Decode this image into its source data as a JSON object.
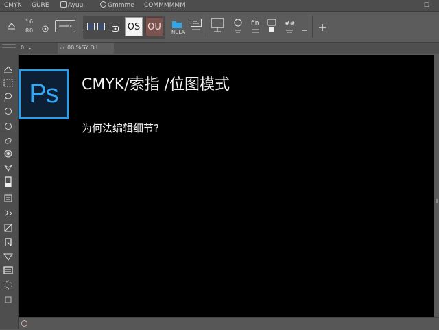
{
  "menubar": {
    "items": [
      "CMYK",
      "GURE",
      "Ayuu",
      "Gmmme",
      "COMMMMMM"
    ],
    "close_glyph": "☐"
  },
  "optbar": {
    "os_label": "OS",
    "ou_label": "OU",
    "folder_label": "NULA"
  },
  "tabbar": {
    "zoom_text": "0",
    "doc_tab": "00 %GY D",
    "tab_marker": "l"
  },
  "document": {
    "logo_text": "Ps",
    "title": "CMYK/索指 /位图模式",
    "subtitle": "为何法编辑细节?"
  },
  "colors": {
    "canvas": "#000000",
    "ps_accent": "#2e9de8",
    "ps_bg": "#0c1f35",
    "ou_button": "#7b5450"
  },
  "tools": [
    "move-tool-icon",
    "marquee-tool-icon",
    "lasso-tool-icon",
    "quick-select-tool-icon",
    "crop-tool-icon",
    "eyedropper-tool-icon",
    "healing-brush-tool-icon",
    "brush-tool-icon",
    "clone-stamp-tool-icon",
    "history-brush-tool-icon",
    "eraser-tool-icon",
    "gradient-tool-icon",
    "blur-tool-icon",
    "dodge-tool-icon",
    "pen-tool-icon",
    "type-tool-icon",
    "shape-tool-icon"
  ]
}
